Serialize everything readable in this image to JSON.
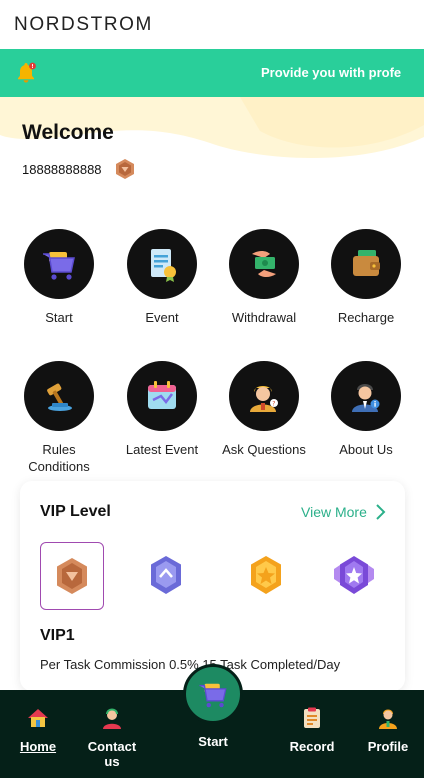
{
  "brand": {
    "logo_text": "NORDSTROM"
  },
  "notice": {
    "text": "Provide you with profe",
    "icon": "bell-icon"
  },
  "user": {
    "welcome": "Welcome",
    "phone": "18888888888"
  },
  "menu_row1": [
    {
      "label": "Start",
      "icon": "cart-icon"
    },
    {
      "label": "Event",
      "icon": "document-icon"
    },
    {
      "label": "Withdrawal",
      "icon": "money-hand-icon"
    },
    {
      "label": "Recharge",
      "icon": "wallet-icon"
    }
  ],
  "menu_row2": [
    {
      "label": "Rules\nConditions",
      "label_line1": "Rules",
      "label_line2": "Conditions",
      "icon": "gavel-icon"
    },
    {
      "label": "Latest Event",
      "icon": "calendar-icon"
    },
    {
      "label": "Ask Questions",
      "icon": "support-agent-icon"
    },
    {
      "label": "About Us",
      "icon": "info-person-icon"
    }
  ],
  "vip": {
    "title": "VIP Level",
    "view_more": "View More",
    "current_level": "VIP1",
    "description": "Per Task Commission 0.5%,15 Task Completed/Day",
    "badges": [
      "bronze-badge-icon",
      "silver-badge-icon",
      "gold-badge-icon",
      "purple-badge-icon"
    ]
  },
  "nav": {
    "home": "Home",
    "contact": "Contact us",
    "start": "Start",
    "record": "Record",
    "profile": "Profile"
  },
  "colors": {
    "accent_green": "#29cf9a",
    "nav_bg": "#052018",
    "link_green": "#2bb08a"
  }
}
